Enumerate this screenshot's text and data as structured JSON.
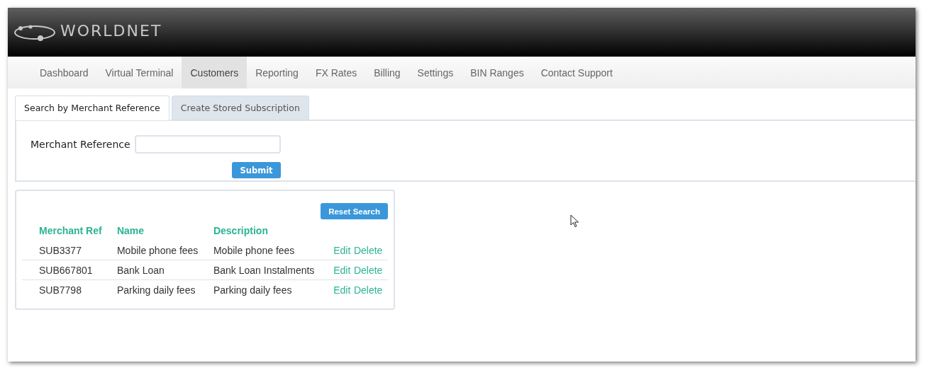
{
  "logo": {
    "text": "WORLDNET"
  },
  "nav": [
    {
      "label": "Dashboard",
      "selected": false
    },
    {
      "label": "Virtual Terminal",
      "selected": false
    },
    {
      "label": "Customers",
      "selected": true
    },
    {
      "label": "Reporting",
      "selected": false
    },
    {
      "label": "FX Rates",
      "selected": false
    },
    {
      "label": "Billing",
      "selected": false
    },
    {
      "label": "Settings",
      "selected": false
    },
    {
      "label": "BIN Ranges",
      "selected": false
    },
    {
      "label": "Contact Support",
      "selected": false
    }
  ],
  "tabs": [
    {
      "label": "Search by Merchant Reference",
      "selected": true
    },
    {
      "label": "Create Stored Subscription",
      "selected": false
    }
  ],
  "search": {
    "label": "Merchant Reference",
    "submit": "Submit"
  },
  "results": {
    "reset": "Reset Search",
    "columns": [
      "Merchant Ref",
      "Name",
      "Description"
    ],
    "rows": [
      {
        "ref": "SUB3377",
        "name": "Mobile phone fees",
        "description": "Mobile phone fees",
        "edit": "Edit",
        "delete": "Delete"
      },
      {
        "ref": "SUB667801",
        "name": "Bank Loan",
        "description": "Bank Loan Instalments",
        "edit": "Edit",
        "delete": "Delete"
      },
      {
        "ref": "SUB7798",
        "name": "Parking daily fees",
        "description": "Parking daily fees",
        "edit": "Edit",
        "delete": "Delete"
      }
    ]
  }
}
